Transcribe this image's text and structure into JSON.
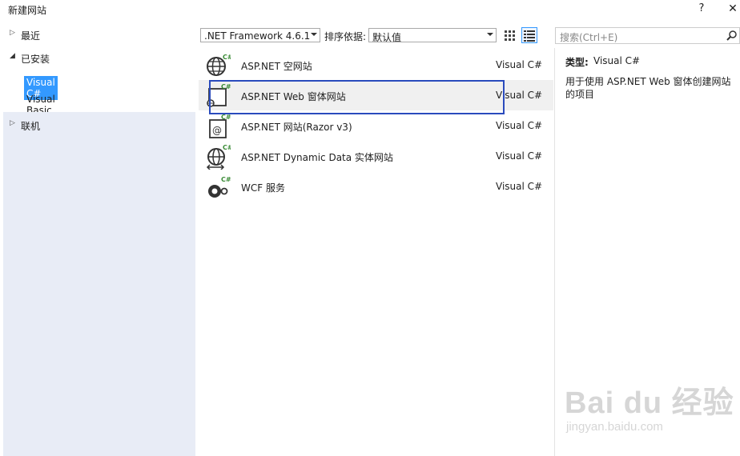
{
  "window": {
    "title": "新建网站",
    "help": "?",
    "close": "✕"
  },
  "tree": {
    "recent": "最近",
    "installed": "已安装",
    "languages": [
      "Visual C#",
      "Visual Basic"
    ],
    "online": "联机"
  },
  "toolbar": {
    "framework": ".NET Framework 4.6.1",
    "sort_label": "排序依据:",
    "sort_value": "默认值",
    "search_placeholder": "搜索(Ctrl+E)"
  },
  "templates": [
    {
      "name": "ASP.NET 空网站",
      "lang": "Visual C#",
      "icon": "globe-csharp-icon"
    },
    {
      "name": "ASP.NET Web 窗体网站",
      "lang": "Visual C#",
      "icon": "webform-csharp-icon",
      "selected": true
    },
    {
      "name": "ASP.NET 网站(Razor v3)",
      "lang": "Visual C#",
      "icon": "razor-csharp-icon"
    },
    {
      "name": "ASP.NET Dynamic Data 实体网站",
      "lang": "Visual C#",
      "icon": "dynamic-data-csharp-icon"
    },
    {
      "name": "WCF 服务",
      "lang": "Visual C#",
      "icon": "wcf-csharp-icon"
    }
  ],
  "info": {
    "type_label": "类型:",
    "type_value": "Visual C#",
    "description": "用于使用 ASP.NET Web 窗体创建网站的项目"
  },
  "watermark": {
    "main": "Bai du 经验",
    "sub": "jingyan.baidu.com"
  },
  "colors": {
    "selection": "#3399ff",
    "highlight_box": "#2a4bbd",
    "left_panel": "#e8ecf6"
  }
}
